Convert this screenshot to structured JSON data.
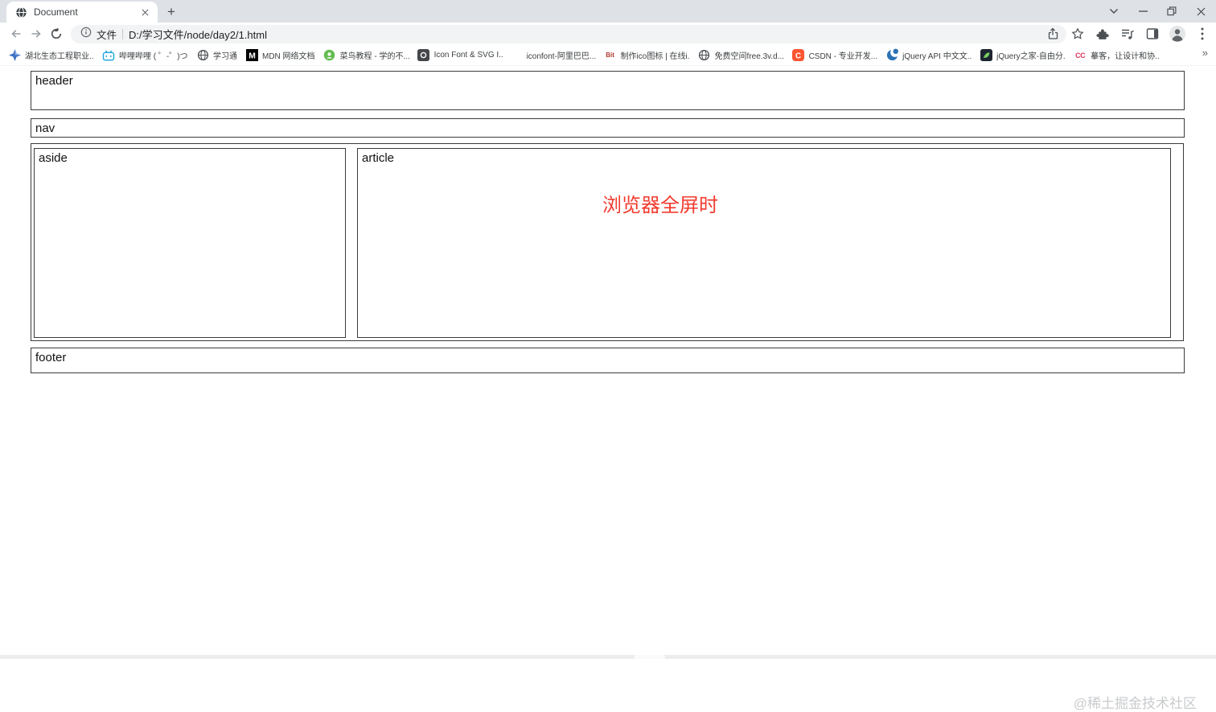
{
  "tabstrip": {
    "tab_title": "Document",
    "new_tab_label": "+"
  },
  "toolbar": {
    "scheme_label": "文件",
    "url": "D:/学习文件/node/day2/1.html"
  },
  "bookmarks": {
    "overflow_label": "»",
    "items": [
      {
        "label": "湖北生态工程职业...",
        "icon": "compass-icon"
      },
      {
        "label": "哔哩哔哩 ( ゜-゜)つ...",
        "icon": "bilibili-icon"
      },
      {
        "label": "学习通",
        "icon": "globe-icon"
      },
      {
        "label": "MDN 网络文档",
        "icon": "mdn-icon",
        "icon_text": "M"
      },
      {
        "label": "菜鸟教程 - 学的不...",
        "icon": "runoob-icon"
      },
      {
        "label": "Icon Font & SVG I...",
        "icon": "icomoon-icon"
      },
      {
        "label": "iconfont-阿里巴巴...",
        "icon": "iconfont-icon"
      },
      {
        "label": "制作ico图标 | 在线i...",
        "icon": "bitbug-icon",
        "icon_text": "Bit"
      },
      {
        "label": "免费空间free.3v.d...",
        "icon": "globe-icon"
      },
      {
        "label": "CSDN - 专业开发...",
        "icon": "csdn-icon",
        "icon_text": "C"
      },
      {
        "label": "jQuery API 中文文...",
        "icon": "jquery-icon"
      },
      {
        "label": "jQuery之家-自由分...",
        "icon": "leaf-icon"
      },
      {
        "label": "摹客，让设计和协...",
        "icon": "mockplus-icon",
        "icon_text": "CC"
      }
    ]
  },
  "page": {
    "header_label": "header",
    "nav_label": "nav",
    "aside_label": "aside",
    "article_label": "article",
    "article_message": "浏览器全屏时",
    "footer_label": "footer"
  },
  "watermark": "@稀土掘金技术社区",
  "colors": {
    "message_red": "#f23b2e",
    "tabstrip_gray": "#dee1e6",
    "omnibox_gray": "#f1f3f4",
    "box_border": "#3b3b3b"
  }
}
